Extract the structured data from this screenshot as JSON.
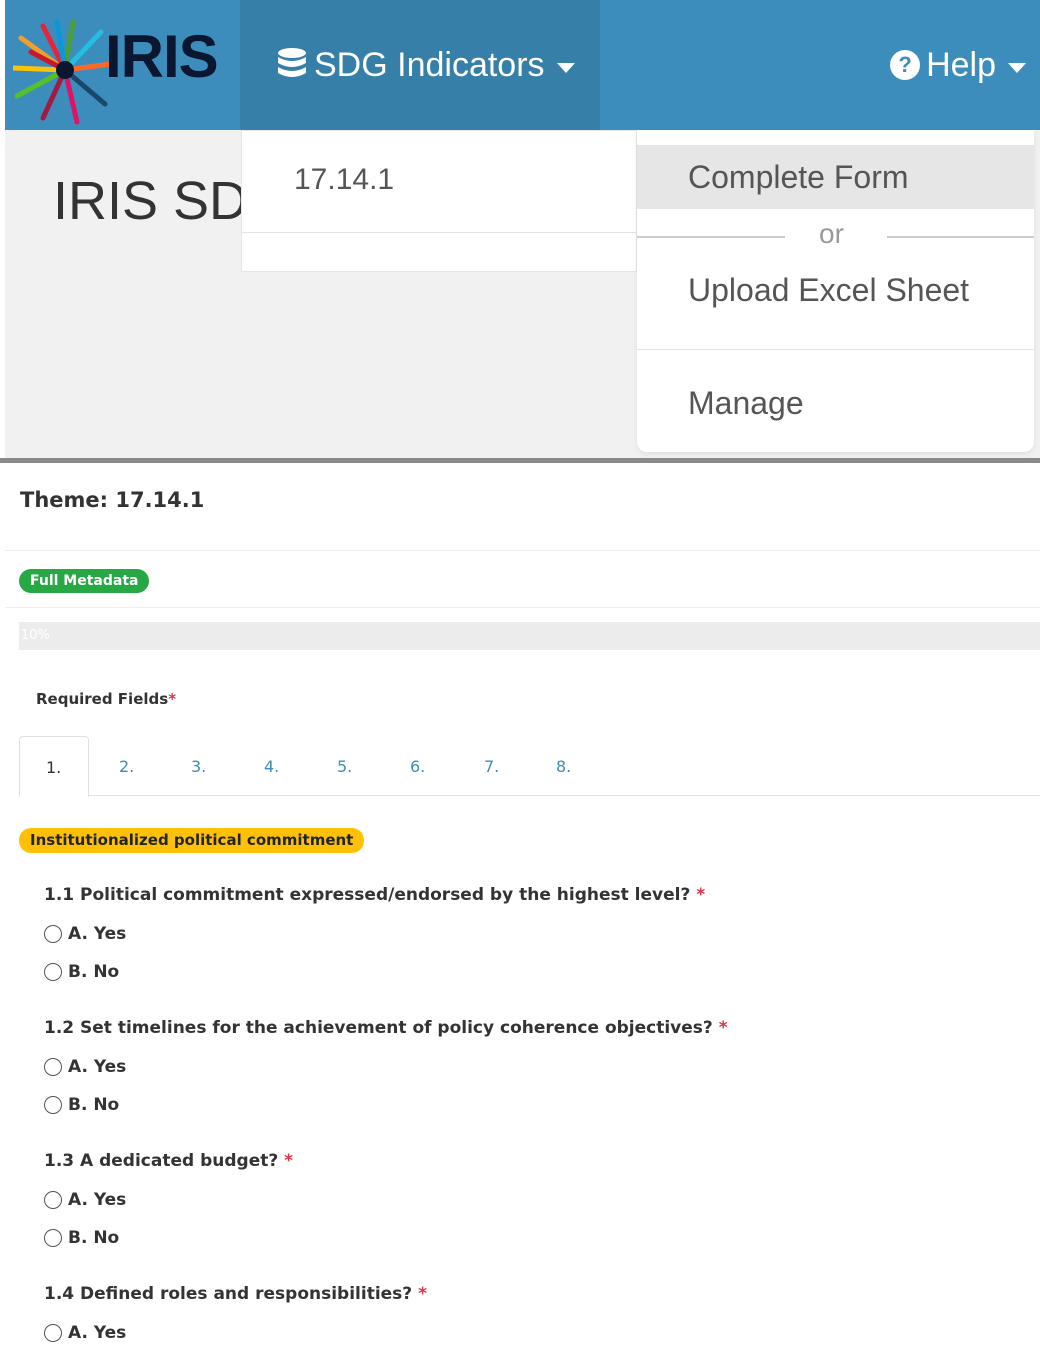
{
  "navbar": {
    "brand": "IRIS",
    "sdg_menu": "SDG Indicators",
    "help_menu": "Help",
    "icons": {
      "sdg": "database-icon",
      "help": "question-circle-icon"
    }
  },
  "page_heading": "IRIS SD(",
  "sdg_dropdown": {
    "items": [
      "17.14.1"
    ]
  },
  "action_dropdown": {
    "complete": "Complete Form",
    "or": "or",
    "upload": "Upload Excel Sheet",
    "manage": "Manage"
  },
  "form": {
    "theme": "Theme: 17.14.1",
    "metadata_badge": "Full Metadata",
    "progress_label": "10%",
    "progress_value": 0.1,
    "required_label": "Required Fields",
    "required_star": "*",
    "tabs": [
      "1.",
      "2.",
      "3.",
      "4.",
      "5.",
      "6.",
      "7.",
      "8."
    ],
    "section_badge": "Institutionalized political commitment",
    "questions": [
      {
        "text": "1.1 Political commitment expressed/endorsed by the highest level?",
        "star": "*",
        "options": [
          "A. Yes",
          "B. No"
        ]
      },
      {
        "text": "1.2 Set timelines for the achievement of policy coherence objectives?",
        "star": "*",
        "options": [
          "A. Yes",
          "B. No"
        ]
      },
      {
        "text": "1.3 A dedicated budget?",
        "star": "*",
        "options": [
          "A. Yes",
          "B. No"
        ]
      },
      {
        "text": "1.4 Defined roles and responsibilities?",
        "star": "*",
        "options": [
          "A. Yes"
        ]
      }
    ]
  },
  "colors": {
    "navbar": "#3c8dbc",
    "navbar_active": "#367fa9",
    "badge_green": "#28a745",
    "badge_yellow": "#ffc107",
    "required": "#dc3545"
  }
}
